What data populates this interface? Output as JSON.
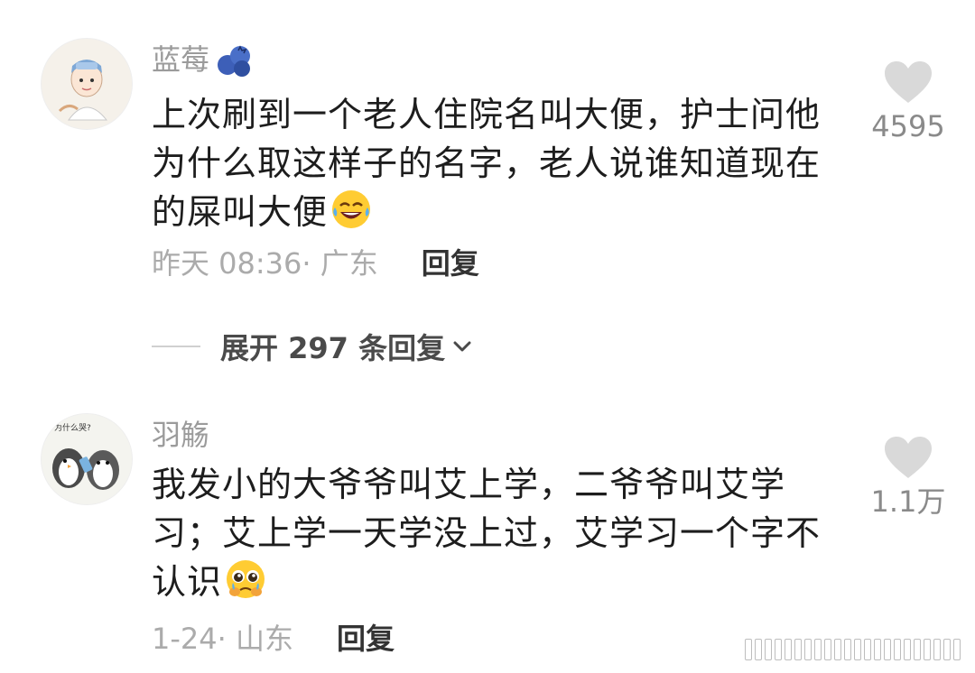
{
  "comments": [
    {
      "username": "蓝莓",
      "username_emoji": "blueberry-emoji",
      "text": "上次刷到一个老人住院名叫大便，护士问他为什么取这样子的名字，老人说谁知道现在的屎叫大便",
      "text_emoji": "rolling-laughing-face-emoji",
      "time": "昨天 08:36",
      "location": "· 广东",
      "reply_label": "回复",
      "likes": "4595"
    },
    {
      "username": "羽觞",
      "text": "我发小的大爷爷叫艾上学，二爷爷叫艾学习；艾上学一天学没上过，艾学习一个字不认识",
      "text_emoji": "pleading-face-emoji",
      "avatar_text": "为什么哭?",
      "time": "1-24",
      "location": "· 山东",
      "reply_label": "回复",
      "likes": "1.1万"
    }
  ],
  "expand_replies": {
    "label": "展开 297 条回复"
  },
  "colors": {
    "text": "#1d1d1d",
    "meta": "#ababab",
    "like_icon": "#d9d9d9",
    "reply": "#333333"
  },
  "icons": [
    "heart-icon",
    "chevron-down-icon"
  ]
}
